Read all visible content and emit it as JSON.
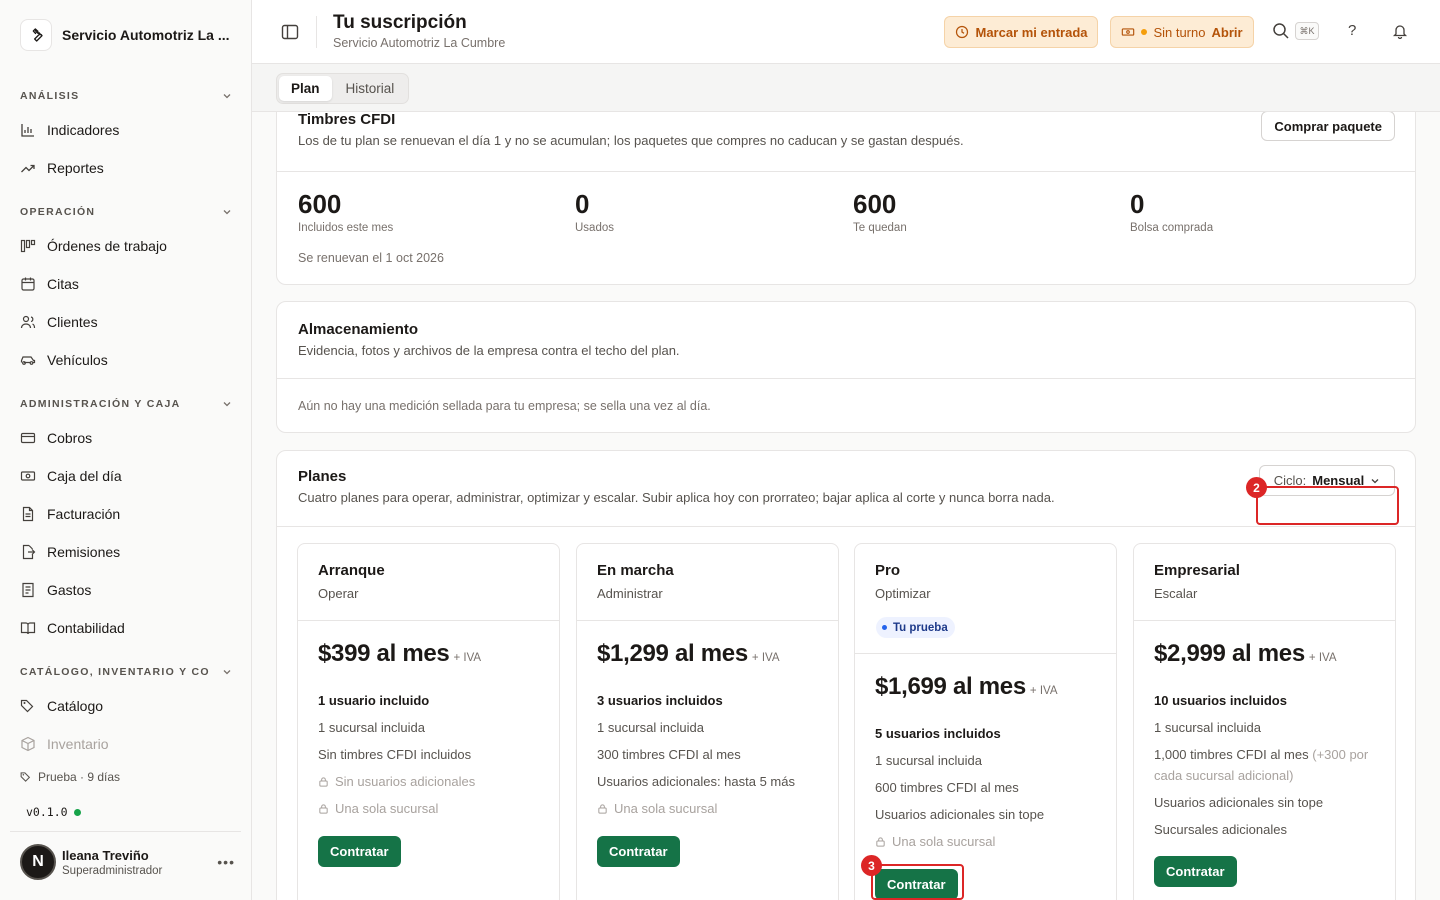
{
  "app": {
    "company": "Servicio Automotriz La ...",
    "version": "v0.1.0",
    "trial": "Prueba · 9 días"
  },
  "sidebar": {
    "sections": [
      {
        "label": "ANÁLISIS",
        "items": [
          {
            "label": "Indicadores",
            "icon": "bar-chart-icon"
          },
          {
            "label": "Reportes",
            "icon": "trend-line-icon"
          }
        ]
      },
      {
        "label": "OPERACIÓN",
        "items": [
          {
            "label": "Órdenes de trabajo",
            "icon": "kanban-icon"
          },
          {
            "label": "Citas",
            "icon": "calendar-icon"
          },
          {
            "label": "Clientes",
            "icon": "users-icon"
          },
          {
            "label": "Vehículos",
            "icon": "car-icon"
          }
        ]
      },
      {
        "label": "ADMINISTRACIÓN Y CAJA",
        "items": [
          {
            "label": "Cobros",
            "icon": "credit-card-icon"
          },
          {
            "label": "Caja del día",
            "icon": "cash-icon"
          },
          {
            "label": "Facturación",
            "icon": "file-text-icon"
          },
          {
            "label": "Remisiones",
            "icon": "file-export-icon"
          },
          {
            "label": "Gastos",
            "icon": "receipt-icon"
          },
          {
            "label": "Contabilidad",
            "icon": "book-icon"
          }
        ]
      },
      {
        "label": "CATÁLOGO, INVENTARIO Y CO...",
        "items": [
          {
            "label": "Catálogo",
            "icon": "tags-icon"
          },
          {
            "label": "Inventario",
            "icon": "box-icon"
          }
        ]
      }
    ],
    "user": {
      "initial": "N",
      "name": "Ileana Treviño",
      "role": "Superadministrador"
    }
  },
  "header": {
    "title": "Tu suscripción",
    "subtitle": "Servicio Automotriz La Cumbre",
    "check_in": "Marcar mi entrada",
    "shift_status": "Sin turno",
    "shift_open": "Abrir",
    "shortcut": "⌘K",
    "help": "?"
  },
  "tabs": [
    "Plan",
    "Historial"
  ],
  "stamps": {
    "title": "Timbres CFDI",
    "description": "Los de tu plan se renuevan el día 1 y no se acumulan; los paquetes que compres no caducan y se gastan después.",
    "buy_label": "Comprar paquete",
    "metrics": [
      {
        "value": "600",
        "label": "Incluidos este mes"
      },
      {
        "value": "0",
        "label": "Usados"
      },
      {
        "value": "600",
        "label": "Te quedan"
      },
      {
        "value": "0",
        "label": "Bolsa comprada"
      }
    ],
    "renewal": "Se renuevan el 1 oct 2026"
  },
  "storage": {
    "title": "Almacenamiento",
    "description": "Evidencia, fotos y archivos de la empresa contra el techo del plan.",
    "empty": "Aún no hay una medición sellada para tu empresa; se sella una vez al día."
  },
  "plans": {
    "title": "Planes",
    "description": "Cuatro planes para operar, administrar, optimizar y escalar. Subir aplica hoy con prorrateo; bajar aplica al corte y nunca borra nada.",
    "cycle_key": "Ciclo:",
    "cycle_value": "Mensual",
    "iva": "+ IVA",
    "buy_label": "Contratar",
    "trial_badge": "Tu prueba",
    "items": [
      {
        "name": "Arranque",
        "tagline": "Operar",
        "price": "$399 al mes",
        "features": [
          "1 usuario incluido",
          "1 sucursal incluida",
          "Sin timbres CFDI incluidos",
          "Sin usuarios adicionales",
          "Una sola sucursal"
        ]
      },
      {
        "name": "En marcha",
        "tagline": "Administrar",
        "price": "$1,299 al mes",
        "features": [
          "3 usuarios incluidos",
          "1 sucursal incluida",
          "300 timbres CFDI al mes",
          "Usuarios adicionales: hasta 5 más",
          "Una sola sucursal"
        ]
      },
      {
        "name": "Pro",
        "tagline": "Optimizar",
        "price": "$1,699 al mes",
        "features": [
          "5 usuarios incluidos",
          "1 sucursal incluida",
          "600 timbres CFDI al mes",
          "Usuarios adicionales sin tope",
          "Una sola sucursal"
        ]
      },
      {
        "name": "Empresarial",
        "tagline": "Escalar",
        "price": "$2,999 al mes",
        "features": [
          "10 usuarios incluidos",
          "1 sucursal incluida",
          "1,000 timbres CFDI al mes",
          "(+300 por cada sucursal adicional)",
          "Usuarios adicionales sin tope",
          "Sucursales adicionales"
        ]
      }
    ]
  },
  "markers": [
    "2",
    "3"
  ]
}
